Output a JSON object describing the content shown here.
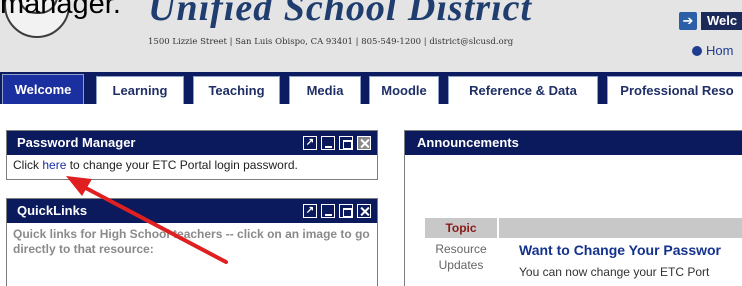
{
  "caption": {
    "text": "manager."
  },
  "header": {
    "title": "Unified School District",
    "address": "1500 Lizzie Street | San Luis Obispo, CA 93401 | 805-549-1200 | district@slcusd.org",
    "welcome_label": "Welc",
    "home_label": "Hom"
  },
  "tabs": [
    {
      "label": "Welcome",
      "active": true
    },
    {
      "label": "Learning"
    },
    {
      "label": "Teaching"
    },
    {
      "label": "Media"
    },
    {
      "label": "Moodle"
    },
    {
      "label": "Reference & Data"
    },
    {
      "label": "Professional Reso"
    }
  ],
  "password_manager": {
    "title": "Password Manager",
    "text_before": "Click ",
    "link": "here",
    "text_after": " to change your ETC Portal login password."
  },
  "quicklinks": {
    "title": "QuickLinks",
    "text": "Quick links for High School teachers -- click on an image to go directly to that resource:"
  },
  "announcements": {
    "title": "Announcements",
    "topic_header": "Topic",
    "rows": [
      {
        "category": "Resource Updates",
        "title": "Want to Change Your Passwor",
        "text": "You can now change your ETC Port"
      }
    ]
  },
  "colors": {
    "nav": "#0d1b60",
    "active_tab": "#1a2fa0",
    "arrow": "#e02020"
  }
}
